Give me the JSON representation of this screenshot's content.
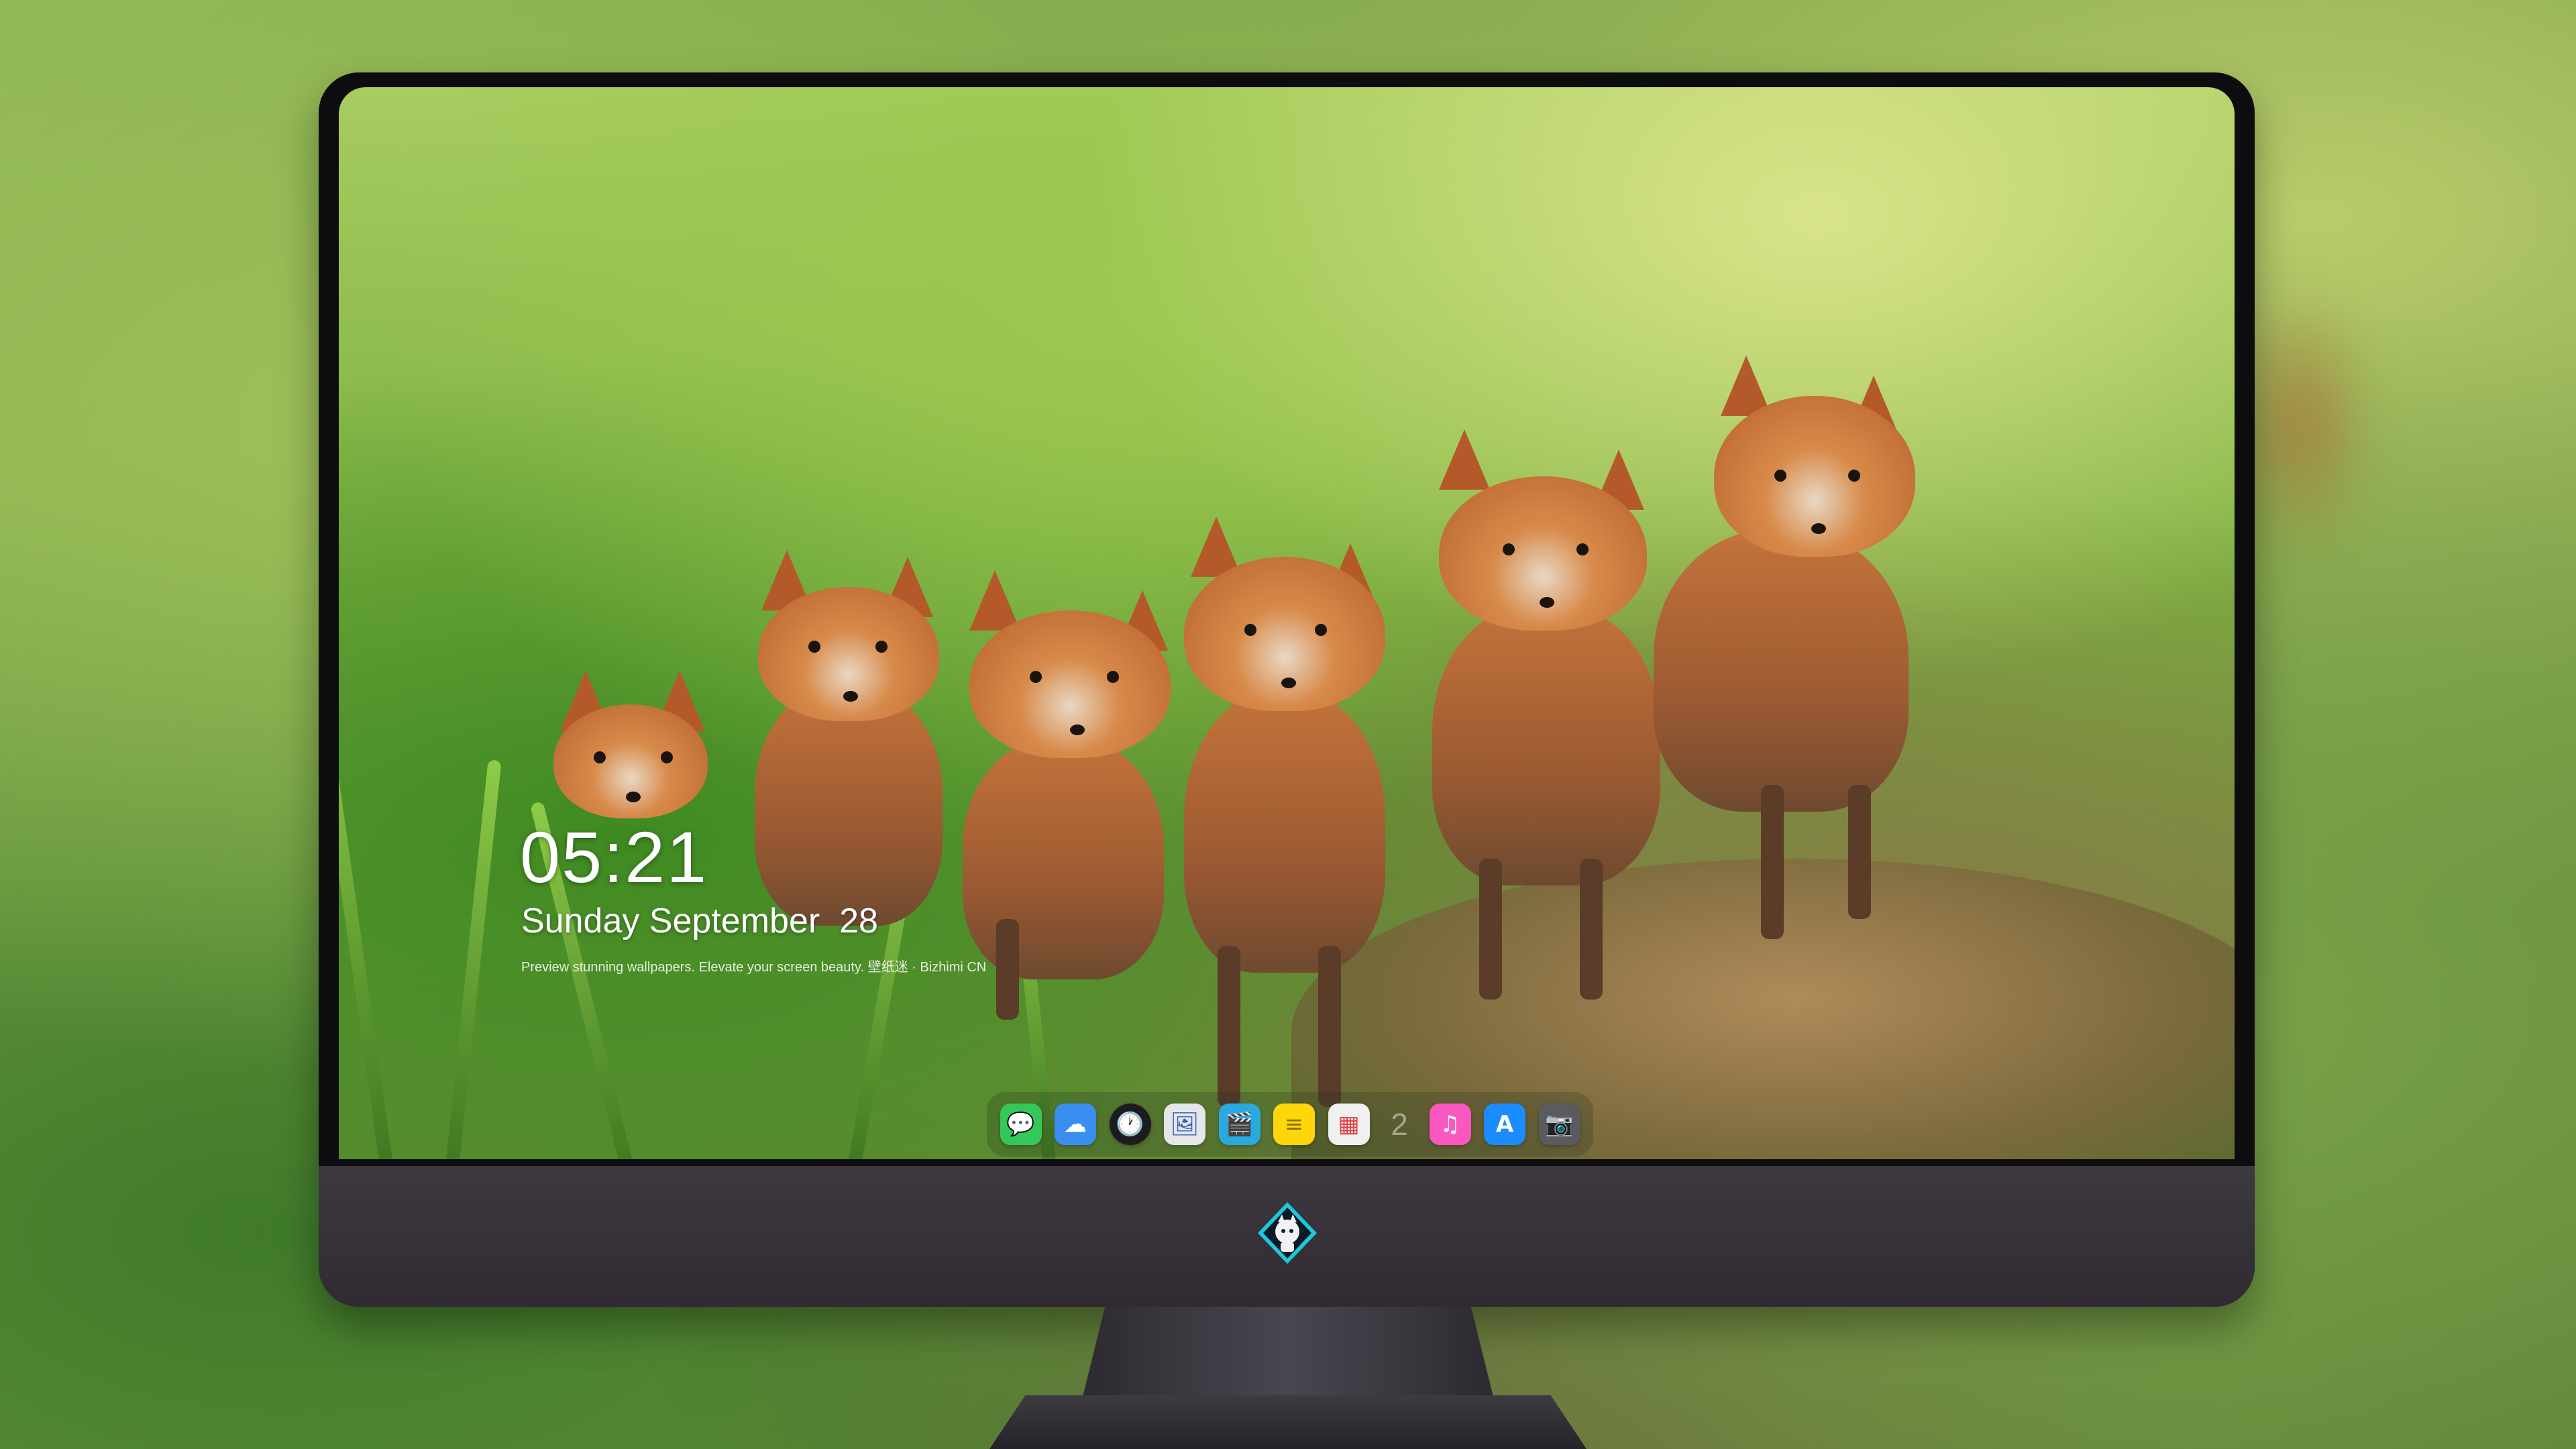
{
  "lock_screen": {
    "time": "05:21",
    "date": "Sunday September  28",
    "tagline": "Preview stunning wallpapers. Elevate your screen beauty. 壁纸迷 · Bizhimi CN"
  },
  "dock": {
    "items": [
      {
        "name": "messages-icon",
        "glyph": "💬",
        "color": "#34c759"
      },
      {
        "name": "weather-icon",
        "glyph": "☁",
        "color": "#3a8ef0"
      },
      {
        "name": "clock-icon",
        "glyph": "🕐",
        "color": "#1c1c1e"
      },
      {
        "name": "preview-icon",
        "glyph": "🖼",
        "color": "#e6e6ea"
      },
      {
        "name": "clips-icon",
        "glyph": "🎬",
        "color": "#2aa8e0"
      },
      {
        "name": "notes-icon",
        "glyph": "≡",
        "color": "#ffd60a"
      },
      {
        "name": "photo-booth-icon",
        "glyph": "▦",
        "color": "#f0f0f0"
      },
      {
        "name": "music-icon",
        "glyph": "♫",
        "color": "#fa57c1"
      },
      {
        "name": "app-store-icon",
        "glyph": "A",
        "color": "#1a8cff"
      },
      {
        "name": "screenshot-icon",
        "glyph": "📷",
        "color": "#5a5a60"
      }
    ],
    "separator": "2"
  },
  "colors": {
    "monitor_bezel": "#0d0d10",
    "monitor_chin": "#3e3840",
    "logo_accent": "#1ec8d8"
  }
}
